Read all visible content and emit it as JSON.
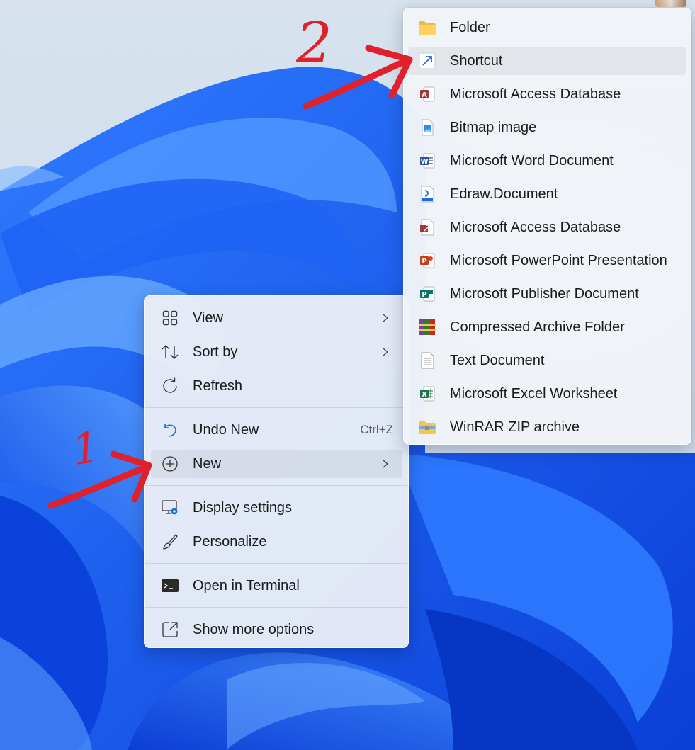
{
  "context_menu": {
    "items": [
      {
        "label": "View",
        "icon": "view-grid-icon",
        "has_submenu": true
      },
      {
        "label": "Sort by",
        "icon": "sort-arrows-icon",
        "has_submenu": true
      },
      {
        "label": "Refresh",
        "icon": "refresh-icon",
        "has_submenu": false
      },
      {
        "label": "Undo New",
        "icon": "undo-icon",
        "shortcut": "Ctrl+Z",
        "has_submenu": false
      },
      {
        "label": "New",
        "icon": "new-plus-icon",
        "has_submenu": true,
        "highlighted": true
      },
      {
        "label": "Display settings",
        "icon": "display-settings-icon",
        "has_submenu": false
      },
      {
        "label": "Personalize",
        "icon": "brush-icon",
        "has_submenu": false
      },
      {
        "label": "Open in Terminal",
        "icon": "terminal-icon",
        "has_submenu": false
      },
      {
        "label": "Show more options",
        "icon": "show-more-icon",
        "has_submenu": false
      }
    ]
  },
  "new_submenu": {
    "items": [
      {
        "label": "Folder",
        "icon": "folder-icon"
      },
      {
        "label": "Shortcut",
        "icon": "shortcut-arrow-icon",
        "highlighted": true
      },
      {
        "label": "Microsoft Access Database",
        "icon": "access-icon"
      },
      {
        "label": "Bitmap image",
        "icon": "bitmap-icon"
      },
      {
        "label": "Microsoft Word Document",
        "icon": "word-icon"
      },
      {
        "label": "Edraw.Document",
        "icon": "edraw-icon"
      },
      {
        "label": "Microsoft Access Database",
        "icon": "access-alt-icon"
      },
      {
        "label": "Microsoft PowerPoint Presentation",
        "icon": "powerpoint-icon"
      },
      {
        "label": "Microsoft Publisher Document",
        "icon": "publisher-icon"
      },
      {
        "label": "Compressed Archive Folder",
        "icon": "winrar-archive-icon"
      },
      {
        "label": "Text Document",
        "icon": "text-document-icon"
      },
      {
        "label": "Microsoft Excel Worksheet",
        "icon": "excel-icon"
      },
      {
        "label": "WinRAR ZIP archive",
        "icon": "winrar-zip-icon"
      }
    ]
  },
  "annotations": {
    "step1_label": "1",
    "step2_label": "2",
    "color": "#e0202a"
  },
  "colors": {
    "accent": "#0067c0",
    "wallpaper_blue": "#1a5cff"
  }
}
